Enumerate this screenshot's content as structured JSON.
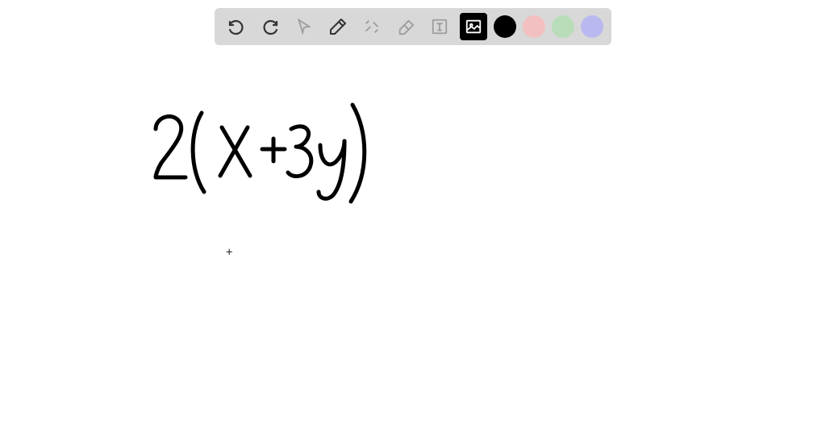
{
  "toolbar": {
    "tools": [
      {
        "name": "undo",
        "icon": "undo",
        "enabled": true
      },
      {
        "name": "redo",
        "icon": "redo",
        "enabled": true
      },
      {
        "name": "pointer",
        "icon": "pointer",
        "enabled": false
      },
      {
        "name": "pencil",
        "icon": "pencil",
        "enabled": true,
        "active": true
      },
      {
        "name": "tools",
        "icon": "tools",
        "enabled": false
      },
      {
        "name": "eraser",
        "icon": "eraser",
        "enabled": false
      },
      {
        "name": "text",
        "icon": "text",
        "enabled": false
      },
      {
        "name": "image",
        "icon": "image",
        "enabled": true,
        "highlighted": true
      }
    ],
    "colors": [
      {
        "name": "black",
        "hex": "#000000",
        "selected": true
      },
      {
        "name": "pink",
        "hex": "#f2c0c0"
      },
      {
        "name": "green",
        "hex": "#b9dcb9"
      },
      {
        "name": "purple",
        "hex": "#b9b9f0"
      }
    ]
  },
  "canvas": {
    "handwriting_expression": "2(x+3y)",
    "crosshair_symbol": "+"
  }
}
